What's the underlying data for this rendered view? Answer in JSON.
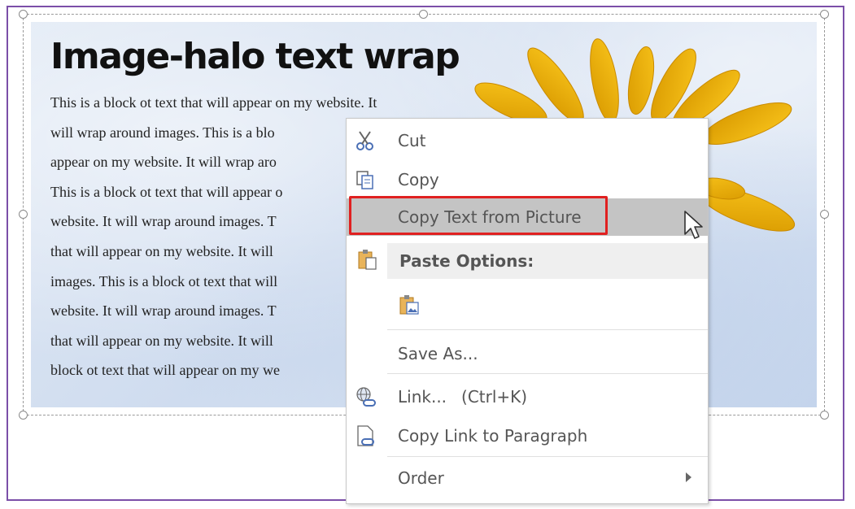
{
  "picture": {
    "title": "Image-halo text wrap",
    "body_lines": [
      "This is a block ot text that will appear on my website. It",
      "will wrap around images. This is a blo",
      "appear on my website. It will wrap aro",
      "This is a block ot text that will appear o",
      "website. It will wrap around images. T",
      "that will appear on my website. It will",
      "images. This is a block ot text that will",
      "website. It will wrap around images. T",
      "that will appear on my website. It will",
      "block ot text that will appear on my we"
    ]
  },
  "context_menu": {
    "cut": {
      "label": "Cut",
      "icon": "scissors-icon"
    },
    "copy": {
      "label": "Copy",
      "icon": "copy-icon"
    },
    "copy_text_from_picture": {
      "label": "Copy Text from Picture"
    },
    "paste_options": {
      "label": "Paste Options:",
      "icon": "clipboard-icon"
    },
    "paste_picture": {
      "icon": "paste-picture-icon"
    },
    "save_as": {
      "label": "Save As..."
    },
    "link": {
      "label": "Link...",
      "shortcut": "(Ctrl+K)",
      "icon": "link-icon"
    },
    "copy_link_to_paragraph": {
      "label": "Copy Link to Paragraph",
      "icon": "copy-link-icon"
    },
    "order": {
      "label": "Order",
      "icon": "chevron-right-icon"
    }
  },
  "colors": {
    "frame_border": "#7b4fa8",
    "highlight_outline": "#e02020",
    "highlight_fill": "#c4c4c4",
    "flower_petal": "#f2b705"
  }
}
